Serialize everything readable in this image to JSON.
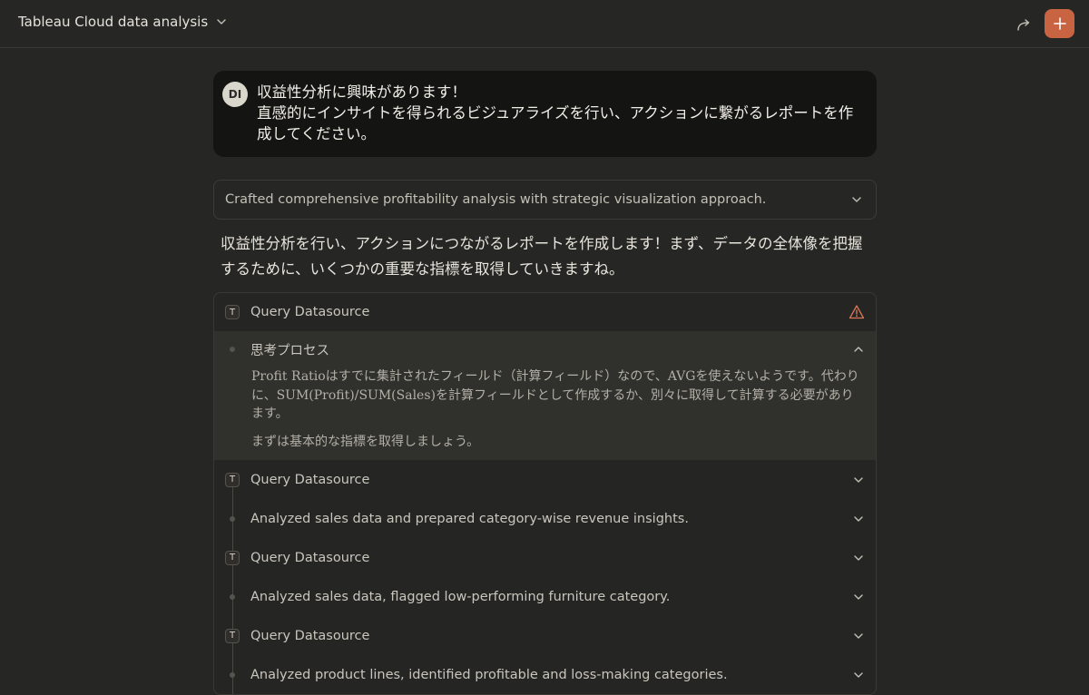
{
  "header": {
    "title": "Tableau Cloud data analysis"
  },
  "user_message": {
    "avatar_initials": "DI",
    "lines": [
      "収益性分析に興味があります！",
      "直感的にインサイトを得られるビジュアライズを行い、アクションに繋がるレポートを作",
      "成してください。"
    ]
  },
  "thinking_summary": "Crafted comprehensive profitability analysis with strategic visualization approach.",
  "assistant_text": "収益性分析を行い、アクションにつながるレポートを作成します！まず、データの全体像を把握するために、いくつかの重要な指標を取得していきますね。",
  "tool_panel": {
    "first_tool": {
      "badge": "T",
      "label": "Query Datasource",
      "status_icon": "warning-icon"
    },
    "thinking_process": {
      "label": "思考プロセス",
      "paragraphs": [
        "Profit Ratioはすでに集計されたフィールド（計算フィールド）なので、AVGを使えないようです。代わりに、SUM(Profit)/SUM(Sales)を計算フィールドとして作成するか、別々に取得して計算する必要があります。",
        "まずは基本的な指標を取得しましょう。"
      ]
    },
    "rows": [
      {
        "type": "tool",
        "badge": "T",
        "label": "Query Datasource"
      },
      {
        "type": "step",
        "label": "Analyzed sales data and prepared category-wise revenue insights."
      },
      {
        "type": "tool",
        "badge": "T",
        "label": "Query Datasource"
      },
      {
        "type": "step",
        "label": "Analyzed sales data, flagged low-performing furniture category."
      },
      {
        "type": "tool",
        "badge": "T",
        "label": "Query Datasource"
      },
      {
        "type": "step",
        "label": "Analyzed product lines, identified profitable and loss-making categories."
      }
    ]
  },
  "colors": {
    "background": "#262624",
    "accent": "#c96442",
    "warning": "#d97757"
  }
}
